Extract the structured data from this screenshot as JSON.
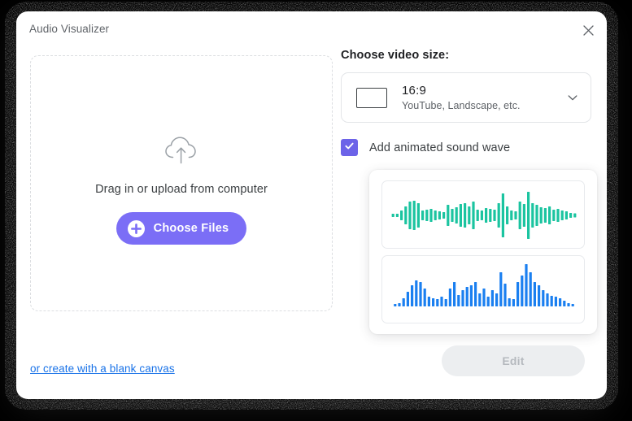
{
  "window": {
    "title": "Audio Visualizer",
    "close_icon": "close-icon"
  },
  "dropzone": {
    "icon": "cloud-upload-icon",
    "hint": "Drag in or upload from computer",
    "button_label": "Choose Files",
    "button_icon": "plus-circle-icon",
    "button_color": "#7b6ef6"
  },
  "blank_canvas": {
    "label": "or create with a blank canvas",
    "color": "#1a73e8"
  },
  "video_size": {
    "section_label": "Choose video size:",
    "icon": "aspect-ratio-rectangle-icon",
    "value": "16:9",
    "description": "YouTube, Landscape, etc.",
    "chevron_icon": "chevron-down-icon"
  },
  "sound_wave": {
    "checkbox_label": "Add animated sound wave",
    "checked": true,
    "checkbox_color": "#6c63e8",
    "check_icon": "check-icon",
    "options": [
      {
        "name": "centered-symmetric-waveform",
        "color": "#1bc4a0",
        "style": "centered",
        "amplitudes": [
          4,
          4,
          12,
          22,
          34,
          36,
          30,
          12,
          14,
          16,
          12,
          10,
          8,
          26,
          16,
          20,
          28,
          30,
          22,
          34,
          14,
          12,
          18,
          16,
          14,
          30,
          54,
          22,
          12,
          10,
          34,
          28,
          58,
          30,
          26,
          20,
          18,
          22,
          14,
          16,
          12,
          10,
          6,
          5
        ]
      },
      {
        "name": "bottom-anchored-bar-waveform",
        "color": "#1a7ff0",
        "style": "baseline",
        "amplitudes": [
          3,
          4,
          10,
          18,
          26,
          32,
          30,
          22,
          12,
          10,
          9,
          12,
          9,
          22,
          30,
          14,
          20,
          24,
          26,
          30,
          16,
          22,
          12,
          20,
          16,
          42,
          28,
          10,
          9,
          30,
          38,
          52,
          42,
          30,
          26,
          20,
          16,
          13,
          12,
          10,
          7,
          4,
          3
        ]
      }
    ]
  },
  "footer": {
    "edit_label": "Edit",
    "edit_disabled": true
  }
}
